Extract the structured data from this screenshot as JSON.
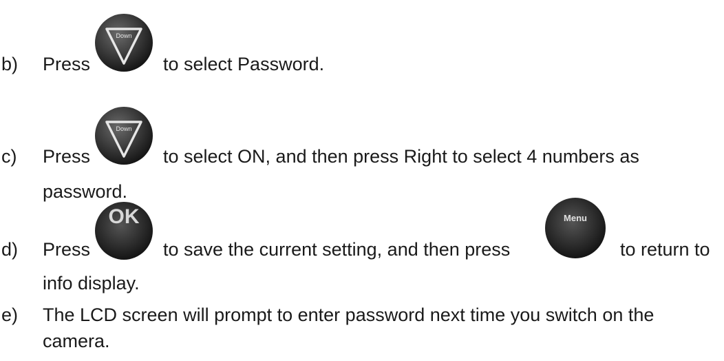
{
  "steps": [
    {
      "label": "b)",
      "pre": "Press",
      "post": "to select Password."
    },
    {
      "label": "c)",
      "pre": "Press",
      "post": "to select ON, and then press Right to select 4 numbers as",
      "cont": "password."
    },
    {
      "label": "d)",
      "pre": "Press",
      "mid": "to save the current setting, and then press",
      "post": "to return to",
      "cont": "info display."
    },
    {
      "label": "e)",
      "text": "The LCD screen will prompt to enter password next time you switch on the",
      "cont": "camera."
    }
  ],
  "buttons": {
    "down": "Down",
    "ok": "OK",
    "menu": "Menu"
  }
}
